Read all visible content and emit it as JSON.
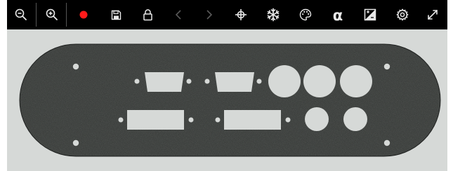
{
  "toolbar": {
    "buttons": [
      {
        "name": "zoom-out-button",
        "icon": "zoom-out-icon",
        "enabled": true
      },
      {
        "name": "zoom-in-button",
        "icon": "zoom-in-icon",
        "enabled": true
      },
      {
        "name": "record-button",
        "icon": "record-dot-icon",
        "enabled": true
      },
      {
        "name": "save-button",
        "icon": "floppy-disk-icon",
        "enabled": true
      },
      {
        "name": "lock-button",
        "icon": "lock-icon",
        "enabled": true
      },
      {
        "name": "previous-button",
        "icon": "chevron-left-icon",
        "enabled": false
      },
      {
        "name": "next-button",
        "icon": "chevron-right-icon",
        "enabled": false
      },
      {
        "name": "crosshair-button",
        "icon": "crosshair-icon",
        "enabled": true
      },
      {
        "name": "snowflake-button",
        "icon": "snowflake-icon",
        "enabled": true
      },
      {
        "name": "palette-button",
        "icon": "palette-icon",
        "enabled": true
      },
      {
        "name": "alpha-button",
        "icon": "alpha-icon",
        "enabled": true
      },
      {
        "name": "contrast-button",
        "icon": "contrast-icon",
        "enabled": true
      },
      {
        "name": "settings-button",
        "icon": "gear-icon",
        "enabled": true
      },
      {
        "name": "fullscreen-button",
        "icon": "expand-icon",
        "enabled": true
      }
    ],
    "alpha_glyph": "α"
  },
  "colors": {
    "toolbar_bg": "#000000",
    "icon": "#e8e8e8",
    "icon_disabled": "#5a5a5a",
    "record": "#ff1a1a",
    "plate": "#2c2f2d",
    "background": "#d6d9d7"
  },
  "viewer": {
    "image": "black-connector-panel-plate"
  }
}
